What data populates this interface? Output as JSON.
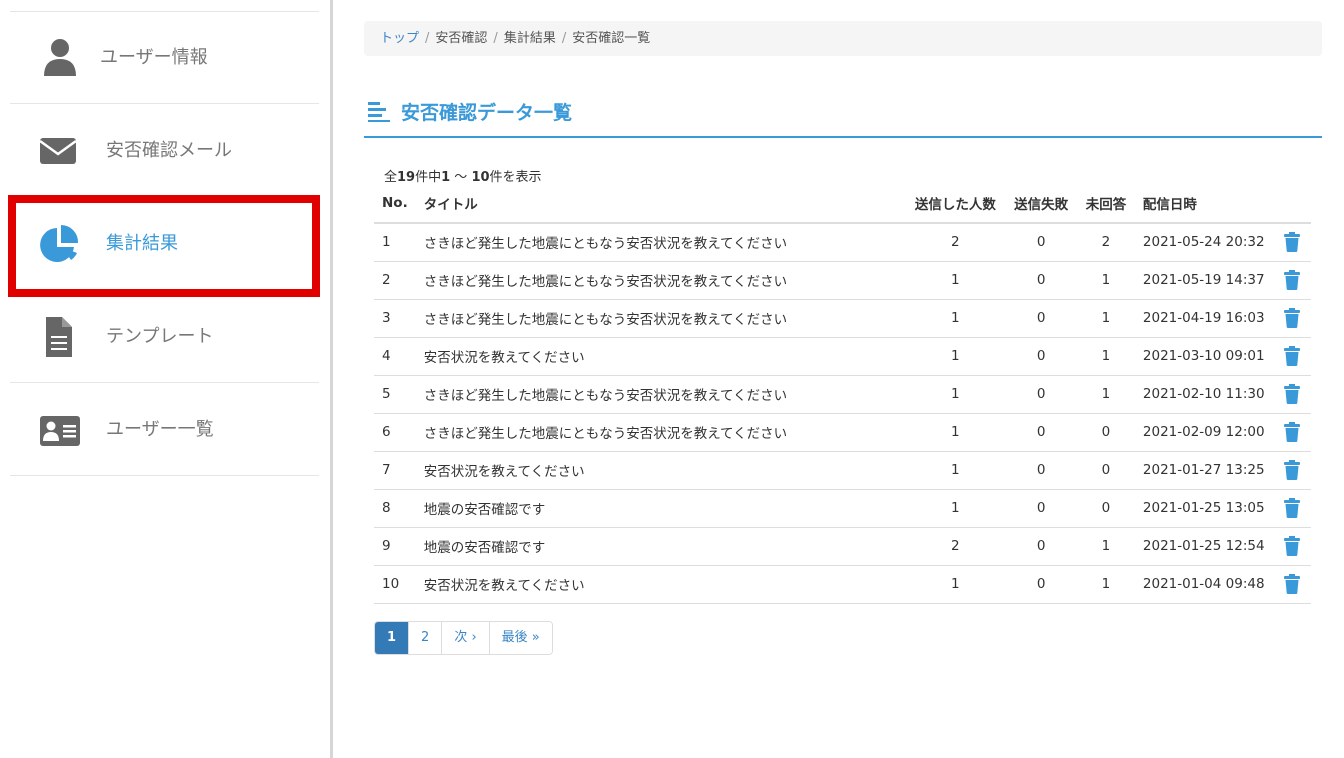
{
  "sidebar": {
    "items": [
      {
        "label": "ユーザー情報",
        "icon": "user-icon"
      },
      {
        "label": "安否確認メール",
        "icon": "envelope-icon"
      },
      {
        "label": "集計結果",
        "icon": "pie-chart-icon",
        "active": true
      },
      {
        "label": "テンプレート",
        "icon": "document-icon"
      },
      {
        "label": "ユーザー一覧",
        "icon": "id-card-icon"
      }
    ],
    "highlight_color": "#e00000",
    "active_color": "#3a9ad9"
  },
  "breadcrumb": {
    "items": [
      "トップ",
      "安否確認",
      "集計結果",
      "安否確認一覧"
    ],
    "separator": "/"
  },
  "heading": {
    "title": "安否確認データ一覧",
    "icon": "list-icon"
  },
  "summary": {
    "prefix": "全",
    "total": "19",
    "mid": "件中",
    "from": "1",
    "tilde": " 〜 ",
    "to": "10",
    "suffix": "件を表示"
  },
  "table": {
    "headers": {
      "no": "No.",
      "title": "タイトル",
      "sent": "送信した人数",
      "failed": "送信失敗",
      "unanswered": "未回答",
      "date": "配信日時"
    },
    "rows": [
      {
        "no": "1",
        "title": "さきほど発生した地震にともなう安否状況を教えてください",
        "sent": "2",
        "failed": "0",
        "unanswered": "2",
        "date": "2021-05-24 20:32"
      },
      {
        "no": "2",
        "title": "さきほど発生した地震にともなう安否状況を教えてください",
        "sent": "1",
        "failed": "0",
        "unanswered": "1",
        "date": "2021-05-19 14:37"
      },
      {
        "no": "3",
        "title": "さきほど発生した地震にともなう安否状況を教えてください",
        "sent": "1",
        "failed": "0",
        "unanswered": "1",
        "date": "2021-04-19 16:03"
      },
      {
        "no": "4",
        "title": "安否状況を教えてください",
        "sent": "1",
        "failed": "0",
        "unanswered": "1",
        "date": "2021-03-10 09:01"
      },
      {
        "no": "5",
        "title": "さきほど発生した地震にともなう安否状況を教えてください",
        "sent": "1",
        "failed": "0",
        "unanswered": "1",
        "date": "2021-02-10 11:30"
      },
      {
        "no": "6",
        "title": "さきほど発生した地震にともなう安否状況を教えてください",
        "sent": "1",
        "failed": "0",
        "unanswered": "0",
        "date": "2021-02-09 12:00"
      },
      {
        "no": "7",
        "title": "安否状況を教えてください",
        "sent": "1",
        "failed": "0",
        "unanswered": "0",
        "date": "2021-01-27 13:25"
      },
      {
        "no": "8",
        "title": "地震の安否確認です",
        "sent": "1",
        "failed": "0",
        "unanswered": "0",
        "date": "2021-01-25 13:05"
      },
      {
        "no": "9",
        "title": "地震の安否確認です",
        "sent": "2",
        "failed": "0",
        "unanswered": "1",
        "date": "2021-01-25 12:54"
      },
      {
        "no": "10",
        "title": "安否状況を教えてください",
        "sent": "1",
        "failed": "0",
        "unanswered": "1",
        "date": "2021-01-04 09:48"
      }
    ],
    "row_action_icon": "trash-icon"
  },
  "pagination": {
    "pages": [
      "1",
      "2"
    ],
    "current": "1",
    "next": "次 ›",
    "last": "最後 »"
  },
  "colors": {
    "accent": "#3a9ad9",
    "link": "#3a85c6",
    "pager_active": "#337ab7"
  }
}
